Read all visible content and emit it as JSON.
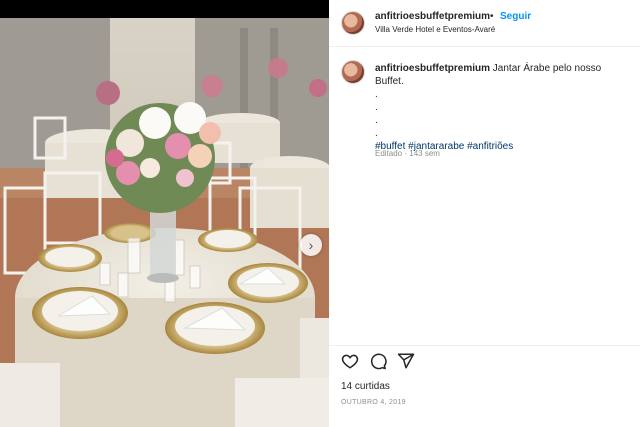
{
  "post": {
    "username": "anfitrioesbuffetpremium",
    "bullet": "•",
    "follow_label": "Seguir",
    "location": "Villa Verde Hotel e Eventos-Avaré",
    "caption": {
      "username": "anfitrioesbuffetpremium",
      "text": "Jantar Árabe pelo nosso Buffet.",
      "dot_lines": [
        ".",
        ".",
        ".",
        "."
      ],
      "hashtags": "#buffet #jantararabe #anfitriões",
      "edited": "Editado · 143 sem"
    },
    "likes": "14 curtidas",
    "date": "OUTUBRO 4, 2019"
  },
  "carousel": {
    "count": 4,
    "active_index": 0
  },
  "icons": {
    "like": "heart-icon",
    "comment": "comment-icon",
    "share": "share-icon",
    "next": "chevron-right-icon"
  },
  "colors": {
    "link": "#0095f6",
    "hashtag": "#00376b",
    "muted": "#8e8e8e",
    "active_dot": "#2f8ef5"
  }
}
